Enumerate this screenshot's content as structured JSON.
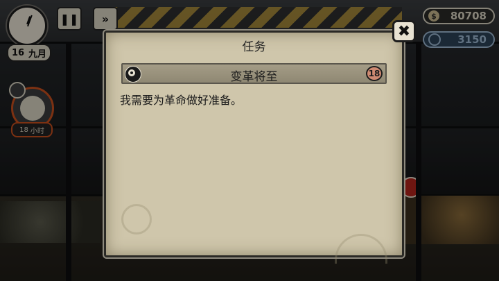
{
  "hud": {
    "date_day": "16",
    "date_month": "九月",
    "money": "80708",
    "money_icon": "$",
    "gems": "3150",
    "pause_symbol": "❚❚",
    "fast_forward_symbol": "»",
    "tenant_timer_value": "18",
    "tenant_timer_unit": "小时"
  },
  "dialog": {
    "title": "任务",
    "close_symbol": "✖",
    "quest": {
      "title": "变革将至",
      "badge": "18",
      "description": "我需要为革命做好准备。"
    }
  },
  "colors": {
    "dialog_bg": "#cfc6ab",
    "quest_bar": "#9b937d",
    "badge": "#cf8a72",
    "accent_orange": "#c84f1e"
  }
}
